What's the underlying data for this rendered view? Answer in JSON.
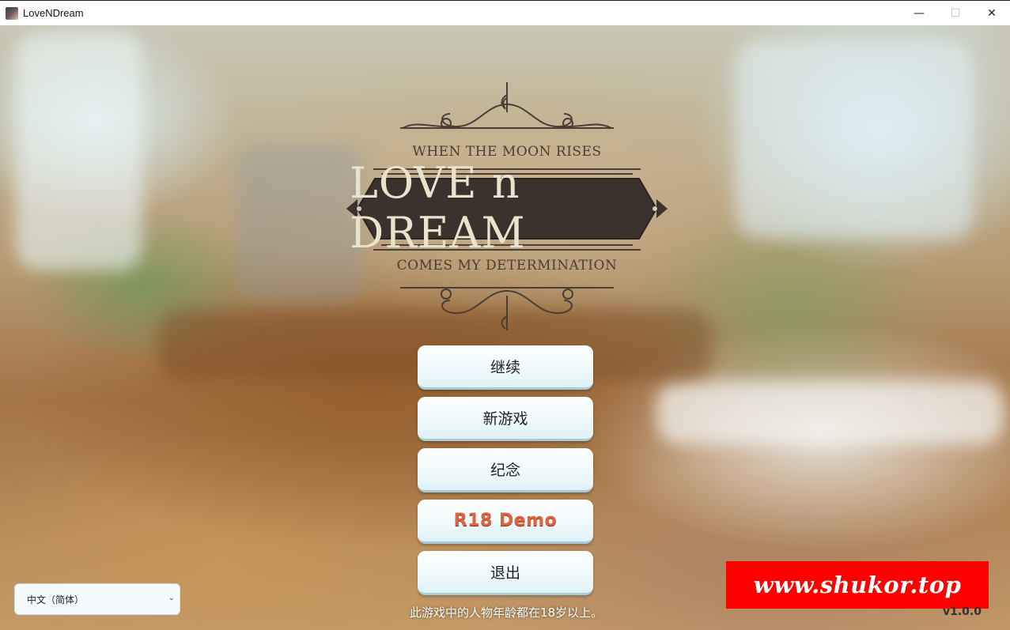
{
  "window": {
    "title": "LoveNDream",
    "controls": {
      "minimize": "—",
      "maximize": "☐",
      "close": "✕"
    }
  },
  "logo": {
    "tagline_top": "WHEN THE MOON RISES",
    "title": "LOVE n DREAM",
    "tagline_bottom": "COMES MY DETERMINATION"
  },
  "menu": {
    "continue": "继续",
    "new_game": "新游戏",
    "memories": "纪念",
    "demo": "R18 Demo",
    "exit": "退出"
  },
  "language": {
    "selected": "中文（简体）"
  },
  "notice": "此游戏中的人物年龄都在18岁以上。",
  "watermark": "www.shukor.top",
  "version": "v1.0.0",
  "colors": {
    "logo_plate": "#3c322d",
    "demo_text": "#e0633f",
    "watermark_bg": "#ff0000"
  }
}
